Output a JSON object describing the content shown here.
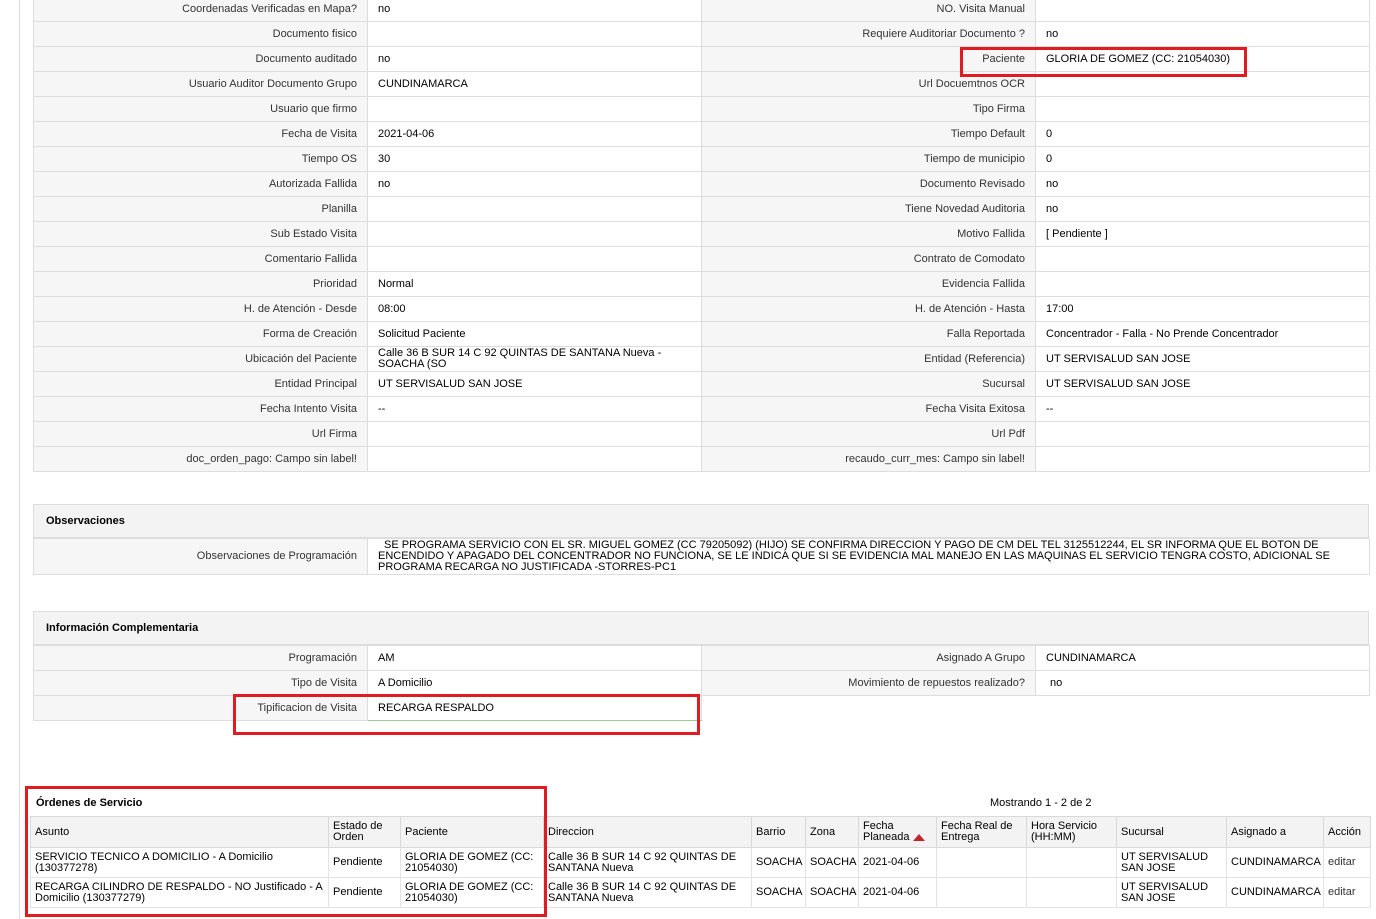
{
  "details": {
    "rows": [
      {
        "l1": "Coordenadas Verificadas en Mapa?",
        "v1": "no",
        "l2": "NO. Visita Manual",
        "v2": ""
      },
      {
        "l1": "Documento fisico",
        "v1": "",
        "l2": "Requiere Auditoriar Documento ?",
        "v2": "no"
      },
      {
        "l1": "Documento auditado",
        "v1": "no",
        "l2": "Paciente",
        "v2": "GLORIA DE GOMEZ (CC: 21054030)"
      },
      {
        "l1": "Usuario Auditor Documento Grupo",
        "v1": "CUNDINAMARCA",
        "l2": "Url Docuemtnos OCR",
        "v2": ""
      },
      {
        "l1": "Usuario que firmo",
        "v1": "",
        "l2": "Tipo Firma",
        "v2": ""
      },
      {
        "l1": "Fecha de Visita",
        "v1": "2021-04-06",
        "l2": "Tiempo Default",
        "v2": "0"
      },
      {
        "l1": "Tiempo OS",
        "v1": "30",
        "l2": "Tiempo de municipio",
        "v2": "0"
      },
      {
        "l1": "Autorizada Fallida",
        "v1": "no",
        "l2": "Documento Revisado",
        "v2": "no"
      },
      {
        "l1": "Planilla",
        "v1": "",
        "l2": "Tiene Novedad Auditoria",
        "v2": "no"
      },
      {
        "l1": "Sub Estado Visita",
        "v1": "",
        "l2": "Motivo Fallida",
        "v2": "[ Pendiente ]"
      },
      {
        "l1": "Comentario Fallida",
        "v1": "",
        "l2": "Contrato de Comodato",
        "v2": ""
      },
      {
        "l1": "Prioridad",
        "v1": "Normal",
        "l2": "Evidencia Fallida",
        "v2": ""
      },
      {
        "l1": "H. de Atención - Desde",
        "v1": "08:00",
        "l2": "H. de Atención - Hasta",
        "v2": "17:00"
      },
      {
        "l1": "Forma de Creación",
        "v1": "Solicitud Paciente",
        "l2": "Falla Reportada",
        "v2": "Concentrador - Falla - No Prende Concentrador"
      },
      {
        "l1": "Ubicación del Paciente",
        "v1": "Calle 36 B SUR 14 C 92 QUINTAS DE SANTANA Nueva - SOACHA (SO",
        "l2": "Entidad (Referencia)",
        "v2": "UT SERVISALUD SAN JOSE"
      },
      {
        "l1": "Entidad Principal",
        "v1": "UT SERVISALUD SAN JOSE",
        "l2": "Sucursal",
        "v2": "UT SERVISALUD SAN JOSE"
      },
      {
        "l1": "Fecha Intento Visita",
        "v1": "--",
        "l2": "Fecha Visita Exitosa",
        "v2": "--"
      },
      {
        "l1": "Url Firma",
        "v1": "",
        "l2": "Url Pdf",
        "v2": ""
      },
      {
        "l1": "doc_orden_pago: Campo sin label!",
        "v1": "",
        "l2": "recaudo_curr_mes: Campo sin label!",
        "v2": ""
      }
    ]
  },
  "observaciones": {
    "title": "Observaciones",
    "label": "Observaciones de Programación",
    "value": "SE PROGRAMA SERVICIO CON EL SR. MIGUEL GOMEZ (CC 79205092) (HIJO) SE CONFIRMA DIRECCION Y PAGO DE CM DEL TEL 3125512244, EL SR INFORMA QUE EL BOTON DE ENCENDIDO Y APAGADO DEL CONCENTRADOR NO FUNCIONA, SE LE INDICA QUE SI SE EVIDENCIA MAL MANEJO EN LAS MAQUINAS EL SERVICIO TENGRA COSTO, ADICIONAL SE PROGRAMA RECARGA NO JUSTIFICADA -STORRES-PC1"
  },
  "info": {
    "title": "Información Complementaria",
    "r1": {
      "l1": "Programación",
      "v1": "AM",
      "l2": "Asignado A Grupo",
      "v2": "CUNDINAMARCA"
    },
    "r2": {
      "l1": "Tipo de Visita",
      "v1": "A Domicilio",
      "l2": "Movimiento de repuestos realizado?",
      "v2": "no"
    },
    "r3": {
      "l1": "Tipificacion de Visita",
      "v1": "RECARGA RESPALDO"
    }
  },
  "orders": {
    "title": "Órdenes de Servicio",
    "count": "Mostrando 1 - 2 de 2",
    "headers": {
      "asunto": "Asunto",
      "estado": "Estado de Orden",
      "paciente": "Paciente",
      "direccion": "Direccion",
      "barrio": "Barrio",
      "zona": "Zona",
      "fecha": "Fecha Planeada",
      "fecha_real": "Fecha Real de Entrega",
      "hora": "Hora Servicio (HH:MM)",
      "sucursal": "Sucursal",
      "asignado": "Asignado a",
      "accion": "Acción"
    },
    "rows": [
      {
        "asunto": "SERVICIO TECNICO A DOMICILIO - A Domicilio (130377278)",
        "estado": "Pendiente",
        "paciente": "GLORIA DE GOMEZ (CC: 21054030)",
        "direccion": "Calle 36 B SUR 14 C 92 QUINTAS DE SANTANA Nueva",
        "barrio": "SOACHA",
        "zona": "SOACHA",
        "fecha": "2021-04-06",
        "fecha_real": "",
        "hora": "",
        "sucursal": "UT SERVISALUD SAN JOSE",
        "asignado": "CUNDINAMARCA",
        "accion": "editar"
      },
      {
        "asunto": "RECARGA CILINDRO DE RESPALDO - NO Justificado - A Domicilio (130377279)",
        "estado": "Pendiente",
        "paciente": "GLORIA DE GOMEZ (CC: 21054030)",
        "direccion": "Calle 36 B SUR 14 C 92 QUINTAS DE SANTANA Nueva",
        "barrio": "SOACHA",
        "zona": "SOACHA",
        "fecha": "2021-04-06",
        "fecha_real": "",
        "hora": "",
        "sucursal": "UT SERVISALUD SAN JOSE",
        "asignado": "CUNDINAMARCA",
        "accion": "editar"
      }
    ]
  },
  "colors": {
    "highlight": "#e11b22",
    "sort_arrow": "#c0262b",
    "header_bg": "#f3f3f3"
  }
}
